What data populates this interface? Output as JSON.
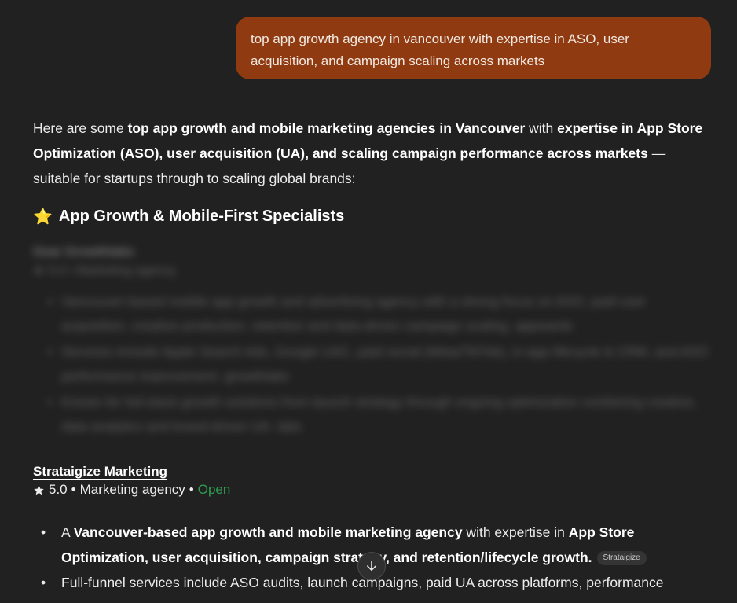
{
  "user_message": "top app growth agency in vancouver with expertise in ASO, user acquisition, and campaign scaling across markets",
  "answer": {
    "intro": {
      "p1": "Here are some ",
      "b1": "top app growth and mobile marketing agencies in Vancouver",
      "p2": " with ",
      "b2": "expertise in App Store Optimization (ASO), user acquisition (UA), and scaling campaign performance across markets",
      "p3": " — suitable for startups through to scaling global brands:"
    },
    "section_heading": {
      "emoji": "⭐",
      "text": "App Growth & Mobile-First Specialists"
    },
    "blurred_entry": {
      "title": "Gear Growthlabs",
      "subtitle": "★ 5.0 • Marketing agency",
      "bullets": [
        "Vancouver-based mobile app growth and advertising agency with a strong focus on ASO, paid user acquisition, creative production, retention and data-driven campaign scaling. appwards",
        "Services include Apple Search Ads, Google UAC, paid social (Meta/TikTok), in-app lifecycle & CRM, and ASO performance improvement. growthlabs",
        "Known for full-stack growth solutions from launch strategy through ongoing optimization combining creative, data analytics and brand-driven UA. labs"
      ]
    },
    "business": {
      "name": "Strataigize Marketing",
      "rating": "5.0",
      "category": "Marketing agency",
      "status": "Open",
      "separator": "•"
    },
    "bullets": [
      {
        "p1": "A ",
        "b1": "Vancouver-based app growth and mobile marketing agency",
        "p2": " with expertise in ",
        "b2": "App Store Optimization, user acquisition, campaign strategy, and retention/lifecycle growth.",
        "chip": "Strataigize"
      },
      {
        "text": "Full-funnel services include ASO audits, launch campaigns, paid UA across platforms, performance"
      }
    ]
  },
  "colors": {
    "background": "#212121",
    "user_bubble": "#8f3a10",
    "open_status": "#2e9e4f",
    "star": "#f5c518"
  },
  "icons": {
    "rating": "star-icon",
    "scroll": "arrow-down-icon"
  }
}
